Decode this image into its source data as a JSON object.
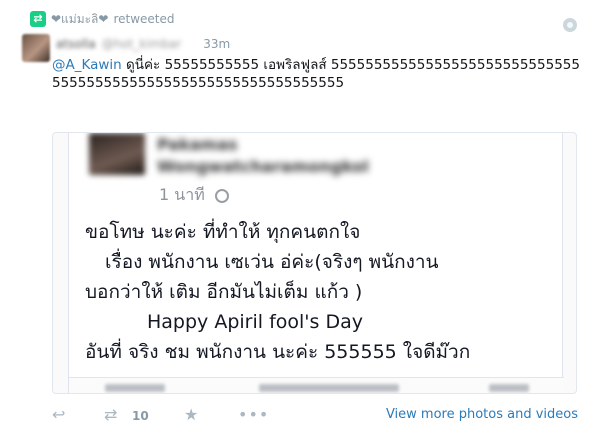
{
  "context": {
    "retweeter": "❤แม่มะลิ❤",
    "verb": "retweeted"
  },
  "author": {
    "name": "atsolla",
    "handle": "@hot_kimbar"
  },
  "tweet": {
    "time": "33m",
    "mention": "@A_Kawin",
    "body": " ดูนี่ค่ะ 55555555555 เอพริลฟูลส์ 555555555555555555555555555555555555555555555555555555555555555"
  },
  "media": {
    "fb_name": "Pakamas",
    "fb_name2": "Wongwatcharamongkol",
    "fb_time": "1 นาที",
    "lines": [
      "ขอโทษ นะค่ะ ที่ทำให้ ทุกคนตกใจ",
      "เรื่อง พนักงาน เซเว่น อ่ค่ะ(จริงๆ พนักงาน",
      "บอกว่าให้ เติม อีกมันไม่เต็ม แก้ว )",
      "Happy Apiril fool's Day",
      "อันที่ จริง ชม พนักงาน นะค่ะ 555555 ใจดีม๊วก"
    ]
  },
  "actions": {
    "retweet_count": "10",
    "view_more": "View more photos and videos"
  },
  "colors": {
    "link": "#2b7bb9",
    "retweet_badge": "#19cf86",
    "muted": "#8899a6"
  }
}
